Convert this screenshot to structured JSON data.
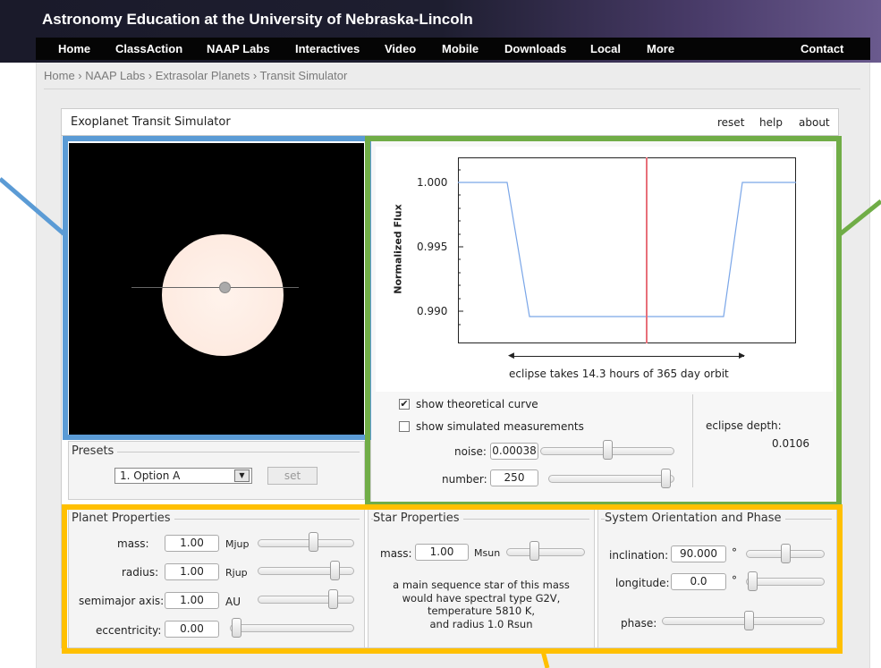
{
  "site": {
    "title": "Astronomy Education at the University of Nebraska-Lincoln",
    "nav": [
      "Home",
      "ClassAction",
      "NAAP Labs",
      "Interactives",
      "Video",
      "Mobile",
      "Downloads",
      "Local",
      "More",
      "Contact"
    ],
    "breadcrumb": "Home › NAAP Labs › Extrasolar Planets › Transit Simulator"
  },
  "app": {
    "title": "Exoplanet Transit Simulator",
    "links": [
      "reset",
      "help",
      "about"
    ]
  },
  "presets": {
    "legend": "Presets",
    "selected": "1. Option A",
    "set_label": "set"
  },
  "graph": {
    "ylabel": "Normalized Flux",
    "yticks": [
      "1.000",
      "0.995",
      "0.990"
    ],
    "eclipse_text": "eclipse takes 14.3 hours of 365 day orbit",
    "show_theoretical": "show theoretical curve",
    "show_simulated": "show simulated measurements",
    "noise_label": "noise:",
    "noise_value": "0.00038",
    "number_label": "number:",
    "number_value": "250",
    "depth_label": "eclipse depth:",
    "depth_value": "0.0106"
  },
  "planet": {
    "legend": "Planet Properties",
    "mass_label": "mass:",
    "mass_value": "1.00",
    "mass_unit": "Mjup",
    "radius_label": "radius:",
    "radius_value": "1.00",
    "radius_unit": "Rjup",
    "axis_label": "semimajor axis:",
    "axis_value": "1.00",
    "axis_unit": "AU",
    "ecc_label": "eccentricity:",
    "ecc_value": "0.00"
  },
  "star": {
    "legend": "Star Properties",
    "mass_label": "mass:",
    "mass_value": "1.00",
    "mass_unit": "Msun",
    "desc": [
      "a main sequence star of this mass",
      "would have spectral type G2V,",
      "temperature 5810 K,",
      "and radius 1.0 Rsun"
    ]
  },
  "orientation": {
    "legend": "System Orientation and Phase",
    "incl_label": "inclination:",
    "incl_value": "90.000",
    "incl_unit": "°",
    "long_label": "longitude:",
    "long_value": "0.0",
    "long_unit": "°",
    "phase_label": "phase:"
  },
  "colors": {
    "highlight_blue": "#5b9bd5",
    "highlight_green": "#70ad47",
    "highlight_yellow": "#ffc000",
    "curve": "#7aa6e8",
    "cursor": "#e8707a"
  }
}
